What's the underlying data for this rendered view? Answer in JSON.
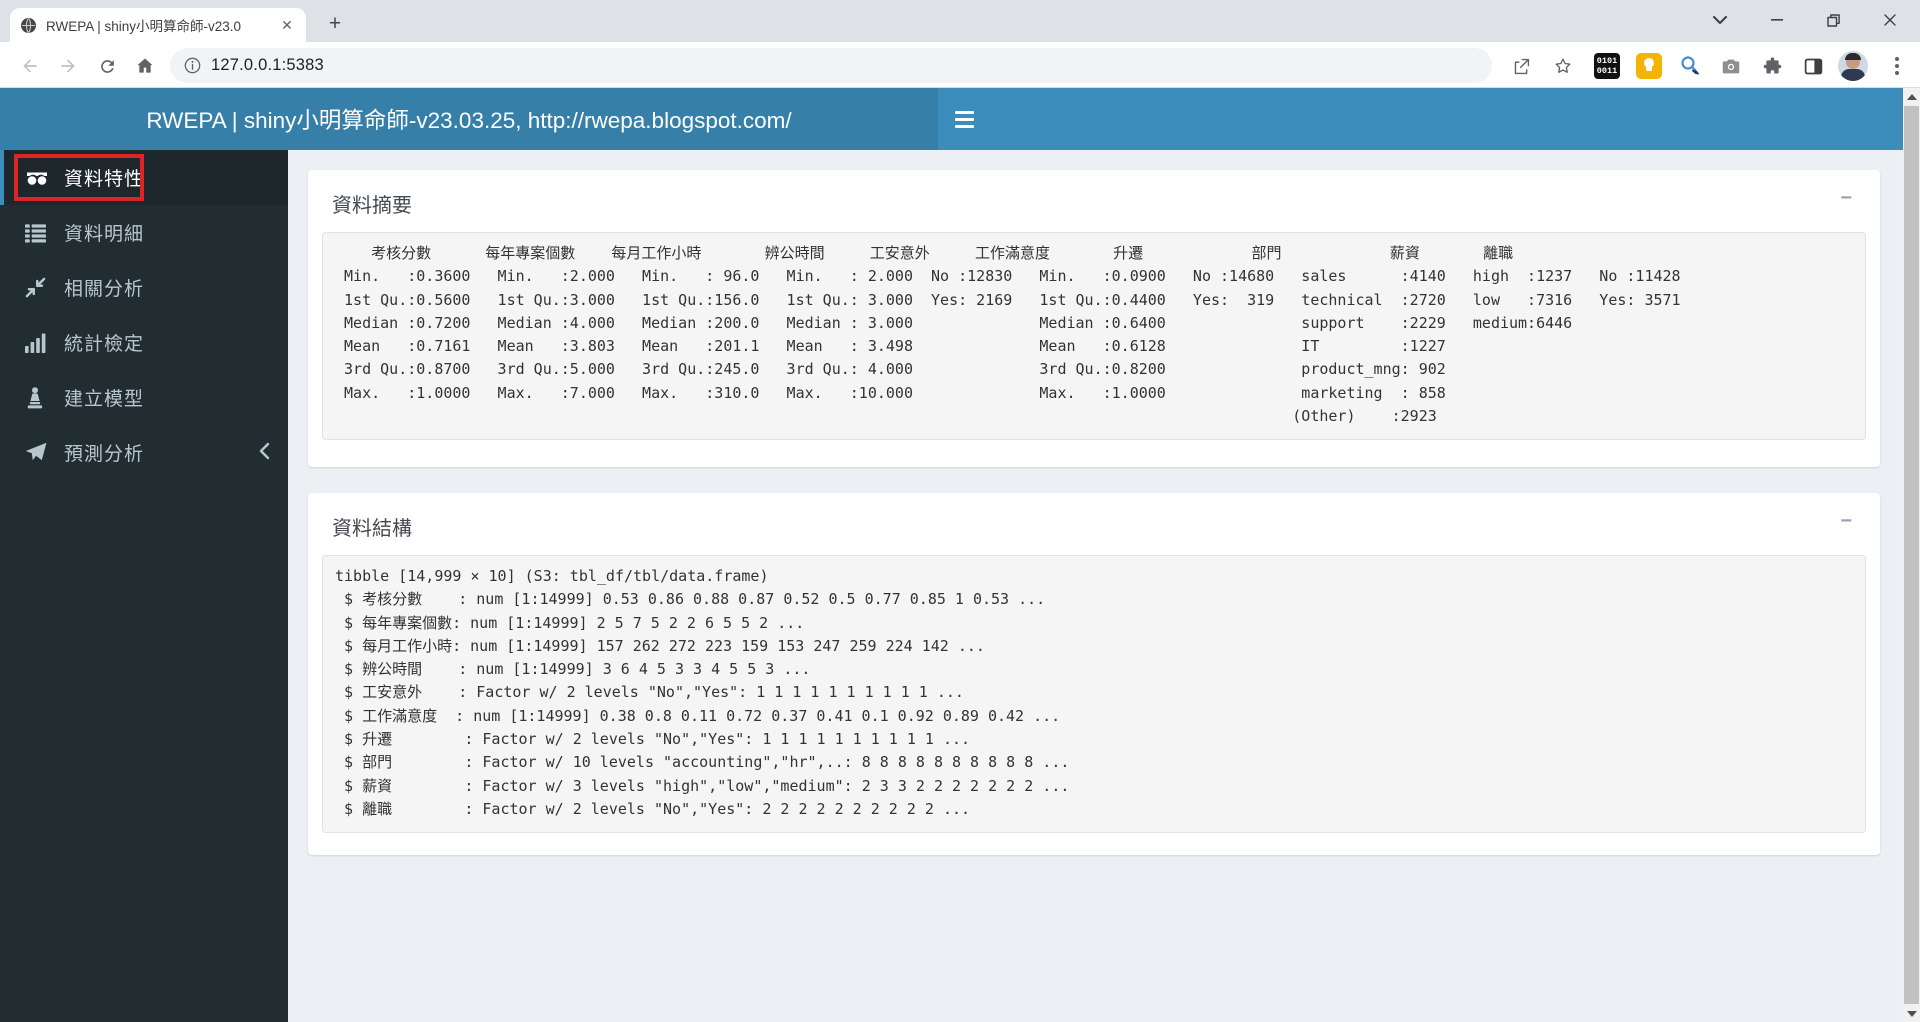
{
  "browser": {
    "tab_title": "RWEPA | shiny小明算命師-v23.0",
    "url": "127.0.0.1:5383"
  },
  "app_header": {
    "title": "RWEPA | shiny小明算命師-v23.03.25, http://rwepa.blogspot.com/"
  },
  "sidebar": {
    "items": [
      {
        "label": "資料特性",
        "icon": "glasses-icon",
        "active": true,
        "annotated": true
      },
      {
        "label": "資料明細",
        "icon": "list-icon",
        "active": false
      },
      {
        "label": "相關分析",
        "icon": "compress-arrows-icon",
        "active": false
      },
      {
        "label": "統計檢定",
        "icon": "bar-chart-icon",
        "active": false
      },
      {
        "label": "建立模型",
        "icon": "chess-piece-icon",
        "active": false
      },
      {
        "label": "預測分析",
        "icon": "paper-plane-icon",
        "active": false,
        "has_submenu": true
      }
    ]
  },
  "boxes": [
    {
      "title": "資料摘要",
      "collapse_label": "−",
      "lines": [
        "    考核分數      每年專案個數    每月工作小時       辨公時間     工安意外     工作滿意度       升遷            部門            薪資       離職",
        " Min.   :0.3600   Min.   :2.000   Min.   : 96.0   Min.   : 2.000  No :12830   Min.   :0.0900   No :14680   sales      :4140   high  :1237   No :11428",
        " 1st Qu.:0.5600   1st Qu.:3.000   1st Qu.:156.0   1st Qu.: 3.000  Yes: 2169   1st Qu.:0.4400   Yes:  319   technical  :2720   low   :7316   Yes: 3571",
        " Median :0.7200   Median :4.000   Median :200.0   Median : 3.000              Median :0.6400               support    :2229   medium:6446",
        " Mean   :0.7161   Mean   :3.803   Mean   :201.1   Mean   : 3.498              Mean   :0.6128               IT         :1227",
        " 3rd Qu.:0.8700   3rd Qu.:5.000   3rd Qu.:245.0   3rd Qu.: 4.000              3rd Qu.:0.8200               product_mng: 902",
        " Max.   :1.0000   Max.   :7.000   Max.   :310.0   Max.   :10.000              Max.   :1.0000               marketing  : 858",
        "                                                                                                          (Other)    :2923"
      ]
    },
    {
      "title": "資料結構",
      "collapse_label": "−",
      "lines": [
        "tibble [14,999 × 10] (S3: tbl_df/tbl/data.frame)",
        " $ 考核分數    : num [1:14999] 0.53 0.86 0.88 0.87 0.52 0.5 0.77 0.85 1 0.53 ...",
        " $ 每年專案個數: num [1:14999] 2 5 7 5 2 2 6 5 5 2 ...",
        " $ 每月工作小時: num [1:14999] 157 262 272 223 159 153 247 259 224 142 ...",
        " $ 辨公時間    : num [1:14999] 3 6 4 5 3 3 4 5 5 3 ...",
        " $ 工安意外    : Factor w/ 2 levels \"No\",\"Yes\": 1 1 1 1 1 1 1 1 1 1 ...",
        " $ 工作滿意度  : num [1:14999] 0.38 0.8 0.11 0.72 0.37 0.41 0.1 0.92 0.89 0.42 ...",
        " $ 升遷        : Factor w/ 2 levels \"No\",\"Yes\": 1 1 1 1 1 1 1 1 1 1 ...",
        " $ 部門        : Factor w/ 10 levels \"accounting\",\"hr\",..: 8 8 8 8 8 8 8 8 8 8 ...",
        " $ 薪資        : Factor w/ 3 levels \"high\",\"low\",\"medium\": 2 3 3 2 2 2 2 2 2 2 ...",
        " $ 離職        : Factor w/ 2 levels \"No\",\"Yes\": 2 2 2 2 2 2 2 2 2 2 ..."
      ]
    }
  ],
  "colors": {
    "navbar_blue": "#3c8dbc",
    "logo_blue": "#367fa9",
    "sidebar_dark": "#222d32",
    "sidebar_active_bg": "#1e282c",
    "sidebar_text": "#b8c7ce",
    "content_bg": "#ecf0f5",
    "annotation_red": "#dd2525",
    "pre_bg": "#f5f5f5",
    "keep_yellow": "#f5b400"
  }
}
